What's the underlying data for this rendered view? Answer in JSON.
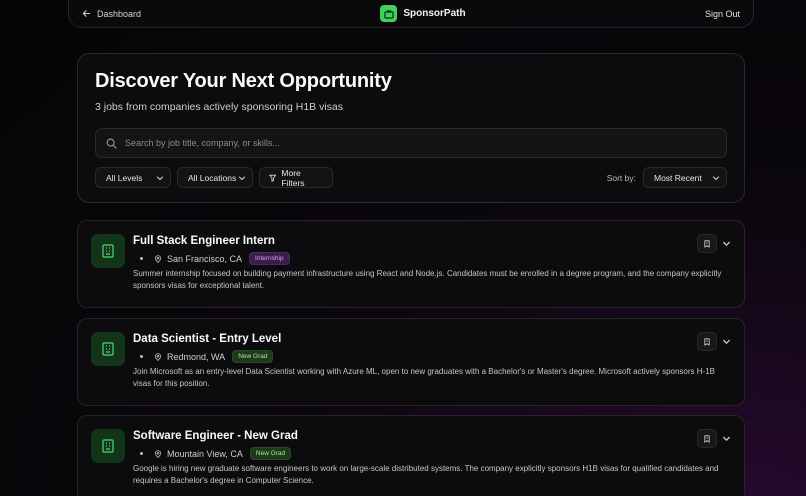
{
  "nav": {
    "back_label": "Dashboard",
    "brand": "SponsorPath",
    "signout_label": "Sign Out"
  },
  "hero": {
    "title": "Discover Your Next Opportunity",
    "subtitle": "3 jobs from companies actively sponsoring H1B visas",
    "search_placeholder": "Search by job title, company, or skills...",
    "search_value": "",
    "level_filter": "All Levels",
    "location_filter": "All Locations",
    "more_filters_label": "More Filters",
    "sort_label": "Sort by:",
    "sort_value": "Most Recent"
  },
  "jobs": [
    {
      "title": "Full Stack Engineer Intern",
      "location": "San Francisco, CA",
      "badge": "Internship",
      "badge_color": "purple",
      "description": "Summer internship focused on building payment infrastructure using React and Node.js. Candidates must be enrolled in a degree program, and the company explicitly sponsors visas for exceptional talent."
    },
    {
      "title": "Data Scientist - Entry Level",
      "location": "Redmond, WA",
      "badge": "New Grad",
      "badge_color": "green",
      "description": "Join Microsoft as an entry-level Data Scientist working with Azure ML, open to new graduates with a Bachelor's or Master's degree. Microsoft actively sponsors H-1B visas for this position."
    },
    {
      "title": "Software Engineer - New Grad",
      "location": "Mountain View, CA",
      "badge": "New Grad",
      "badge_color": "green",
      "description": "Google is hiring new graduate software engineers to work on large-scale distributed systems. The company explicitly sponsors H1B visas for qualified candidates and requires a Bachelor's degree in Computer Science."
    }
  ],
  "colors": {
    "accent_green": "#3fd15a",
    "icon_bg": "#12351a",
    "internship_badge": "#d2a6f2",
    "newgrad_badge": "#a9e0a0"
  }
}
